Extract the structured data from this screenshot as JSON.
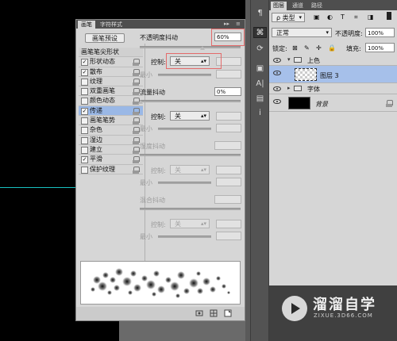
{
  "brush_panel": {
    "tabs": [
      "画笔",
      "字符样式"
    ],
    "panel_controls": [
      "▸▸",
      "≡"
    ],
    "preset_button": "画笔预设",
    "list_header": "画笔笔尖形状",
    "items": [
      {
        "label": "形状动态",
        "checked": true
      },
      {
        "label": "散布",
        "checked": true
      },
      {
        "label": "纹理",
        "checked": false
      },
      {
        "label": "双重画笔",
        "checked": false
      },
      {
        "label": "颜色动态",
        "checked": false
      },
      {
        "label": "传递",
        "checked": true
      },
      {
        "label": "画笔笔势",
        "checked": false
      },
      {
        "label": "杂色",
        "checked": false
      },
      {
        "label": "湿边",
        "checked": false
      },
      {
        "label": "建立",
        "checked": false
      },
      {
        "label": "平滑",
        "checked": true
      },
      {
        "label": "保护纹理",
        "checked": false
      }
    ],
    "opacity_jitter_label": "不透明度抖动",
    "opacity_jitter_value": "60%",
    "control_label": "控制:",
    "control_value": "关",
    "min_label": "最小",
    "flow_jitter_label": "流量抖动",
    "flow_jitter_value": "0%",
    "wetness_jitter_label": "湿度抖动",
    "mix_jitter_label": "混合抖动",
    "checkmark": "✓"
  },
  "tools": [
    "¶",
    "⌘",
    "⟳",
    "▣",
    "A|",
    "▤",
    "i"
  ],
  "layers_panel": {
    "tabs": [
      "图层",
      "通道",
      "路径"
    ],
    "filter_kind": "ρ 类型",
    "filter_icons": [
      "▣",
      "◐",
      "T",
      "⌗",
      "◨"
    ],
    "blend_mode": "正常",
    "opacity_label": "不透明度:",
    "opacity_value": "100%",
    "lock_label": "锁定:",
    "lock_icons": [
      "⊠",
      "✎",
      "✛",
      "🔒"
    ],
    "fill_label": "填充:",
    "fill_value": "100%",
    "layers": [
      {
        "name": "上色",
        "kind": "group",
        "expanded": true
      },
      {
        "name": "图层 3",
        "kind": "layer",
        "selected": true
      },
      {
        "name": "字体",
        "kind": "group",
        "expanded": false
      },
      {
        "name": "背景",
        "kind": "background"
      }
    ]
  },
  "watermark": {
    "title": "溜溜自学",
    "url": "ZIXUE.3D66.COM"
  }
}
